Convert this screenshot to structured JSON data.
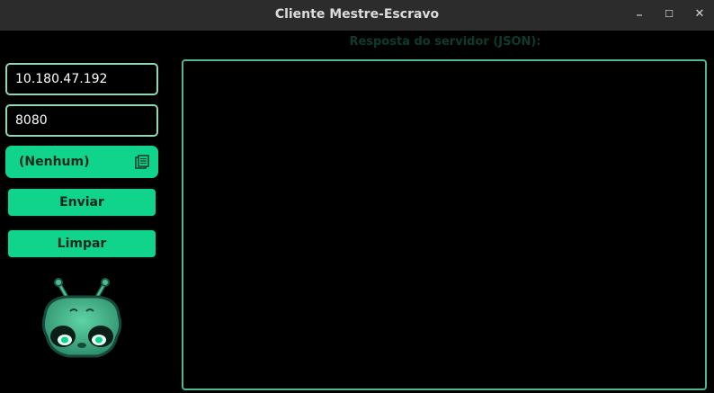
{
  "window": {
    "title": "Cliente Mestre-Escravo",
    "controls": {
      "minimize": "–",
      "maximize": "☐",
      "close": "✕"
    }
  },
  "form": {
    "ip_value": "10.180.47.192",
    "port_value": "8080",
    "selection": "(Nenhum)",
    "send_label": "Enviar",
    "clear_label": "Limpar"
  },
  "response": {
    "label": "Resposta do servidor (JSON):",
    "content": ""
  },
  "icons": {
    "combo": "file-picker-icon",
    "mascot": "alien-mascot-logo"
  },
  "colors": {
    "accent": "#10d48c",
    "border": "#8fd8b2",
    "background": "#000000",
    "titlebar": "#2c2c2c"
  }
}
